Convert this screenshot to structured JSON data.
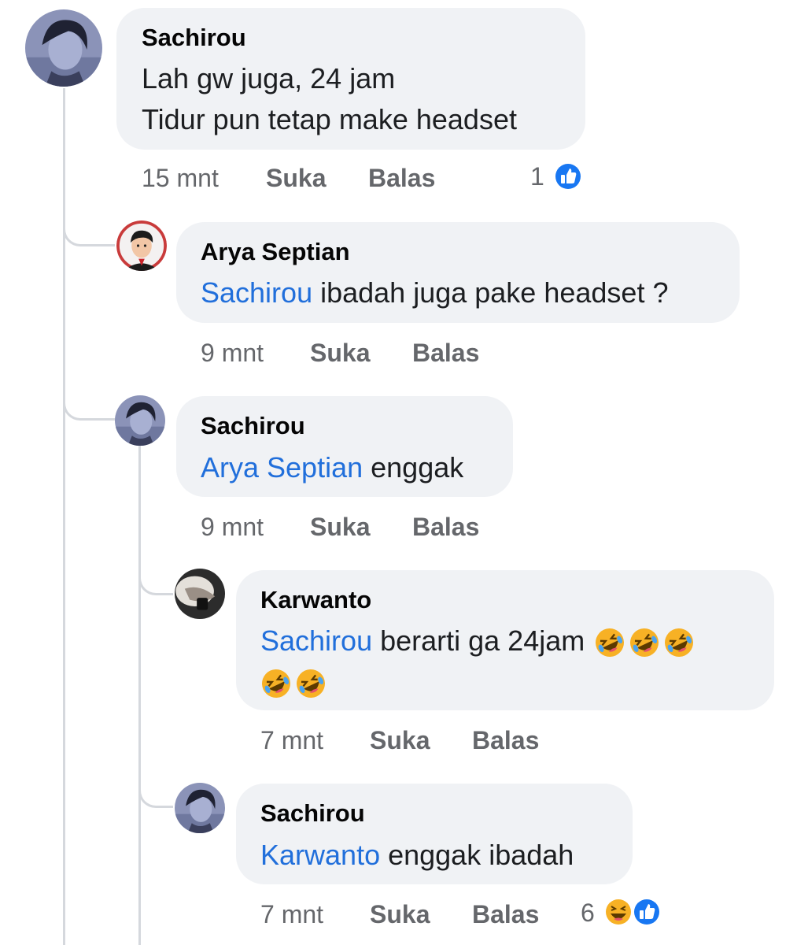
{
  "comments": [
    {
      "author": "Sachirou",
      "line1": "Lah gw juga, 24 jam",
      "line2": "Tidur pun tetap make headset",
      "time": "15 mnt",
      "like": "Suka",
      "reply": "Balas",
      "reaction_count": "1",
      "reactions": [
        "like-icon"
      ]
    },
    {
      "author": "Arya Septian",
      "mention": "Sachirou",
      "text": " ibadah juga pake headset ?",
      "time": "9 mnt",
      "like": "Suka",
      "reply": "Balas"
    },
    {
      "author": "Sachirou",
      "mention": "Arya Septian",
      "text": " enggak",
      "time": "9 mnt",
      "like": "Suka",
      "reply": "Balas"
    },
    {
      "author": "Karwanto",
      "mention": "Sachirou",
      "text": " berarti ga 24jam",
      "emojis_line1": [
        "rolling-laughing-emoji",
        "rolling-laughing-emoji",
        "rolling-laughing-emoji"
      ],
      "emojis_line2": [
        "rolling-laughing-emoji",
        "rolling-laughing-emoji"
      ],
      "time": "7 mnt",
      "like": "Suka",
      "reply": "Balas"
    },
    {
      "author": "Sachirou",
      "mention": "Karwanto",
      "text": " enggak ibadah",
      "time": "7 mnt",
      "like": "Suka",
      "reply": "Balas",
      "reaction_count": "6",
      "reactions": [
        "haha-icon",
        "like-icon"
      ]
    }
  ],
  "colors": {
    "bubble": "#f0f2f5",
    "mention": "#216fdb",
    "meta": "#65676b",
    "like_blue": "#1877f2",
    "haha_yellow": "#f7b125",
    "thread_line": "#d5d8dd"
  }
}
